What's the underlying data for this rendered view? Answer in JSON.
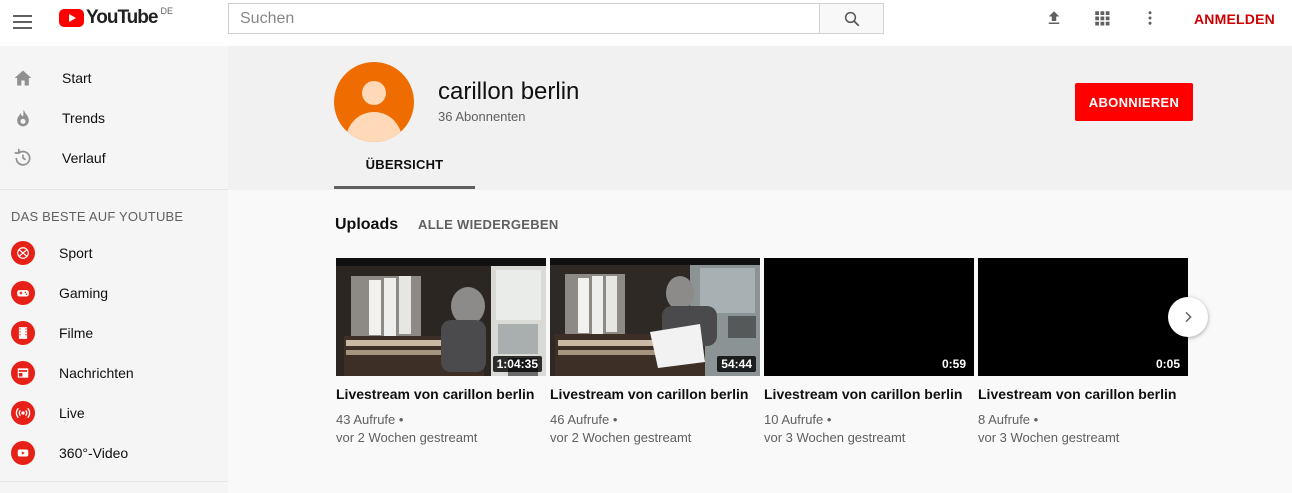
{
  "masthead": {
    "logo_text": "YouTube",
    "logo_country": "DE",
    "search_placeholder": "Suchen",
    "signin_label": "ANMELDEN"
  },
  "sidebar": {
    "main_items": [
      {
        "label": "Start",
        "icon": "home-icon"
      },
      {
        "label": "Trends",
        "icon": "flame-icon"
      },
      {
        "label": "Verlauf",
        "icon": "history-icon"
      }
    ],
    "best_heading": "DAS BESTE AUF YOUTUBE",
    "best_items": [
      {
        "label": "Sport",
        "icon": "sport-icon"
      },
      {
        "label": "Gaming",
        "icon": "gaming-icon"
      },
      {
        "label": "Filme",
        "icon": "film-icon"
      },
      {
        "label": "Nachrichten",
        "icon": "news-icon"
      },
      {
        "label": "Live",
        "icon": "live-icon"
      },
      {
        "label": "360°-Video",
        "icon": "video-360-icon"
      }
    ]
  },
  "channel": {
    "name": "carillon berlin",
    "subscribers": "36 Abonnenten",
    "subscribe_label": "ABONNIEREN",
    "tab_label": "ÜBERSICHT"
  },
  "shelf": {
    "title": "Uploads",
    "play_all": "ALLE WIEDERGEBEN",
    "videos": [
      {
        "title": "Livestream von carillon berlin",
        "duration": "1:04:35",
        "views": "43 Aufrufe •",
        "age": "vor 2 Wochen gestreamt"
      },
      {
        "title": "Livestream von carillon berlin",
        "duration": "54:44",
        "views": "46 Aufrufe •",
        "age": "vor 2 Wochen gestreamt"
      },
      {
        "title": "Livestream von carillon berlin",
        "duration": "0:59",
        "views": "10 Aufrufe •",
        "age": "vor 3 Wochen gestreamt"
      },
      {
        "title": "Livestream von carillon berlin",
        "duration": "0:05",
        "views": "8 Aufrufe •",
        "age": "vor 3 Wochen gestreamt"
      }
    ]
  },
  "colors": {
    "brand_red": "#ff0000",
    "signin_red": "#cc0000",
    "avatar_orange": "#ef6c00",
    "category_red": "#e62117"
  }
}
